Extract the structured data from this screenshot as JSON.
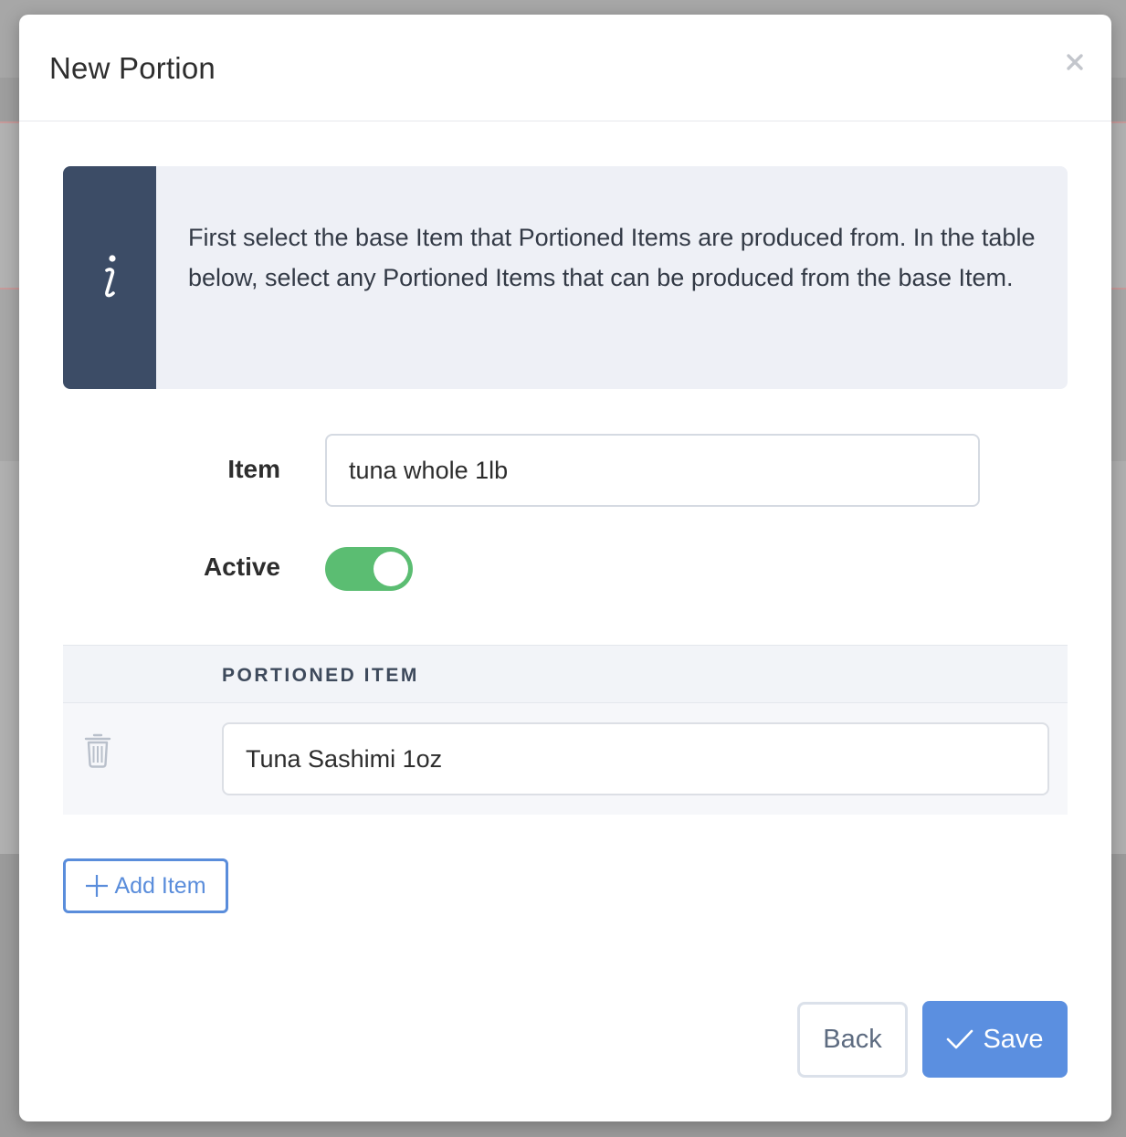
{
  "modal": {
    "title": "New Portion",
    "close_icon": "close-icon"
  },
  "info": {
    "icon": "info-icon",
    "text": "First select the base Item that Portioned Items are produced from. In the table below, select any Portioned Items that can be produced from the base Item."
  },
  "form": {
    "item_label": "Item",
    "item_value": "tuna whole 1lb",
    "active_label": "Active",
    "active_value": true
  },
  "table": {
    "columns": [
      "PORTIONED ITEM"
    ],
    "rows": [
      {
        "portioned_item": "Tuna Sashimi 1oz",
        "delete_icon": "trash-icon"
      }
    ]
  },
  "buttons": {
    "add_item_label": "Add Item",
    "back_label": "Back",
    "save_label": "Save"
  },
  "colors": {
    "accent": "#5b8fe0",
    "toggle_on": "#5bbd72",
    "info_side": "#3c4c66"
  }
}
